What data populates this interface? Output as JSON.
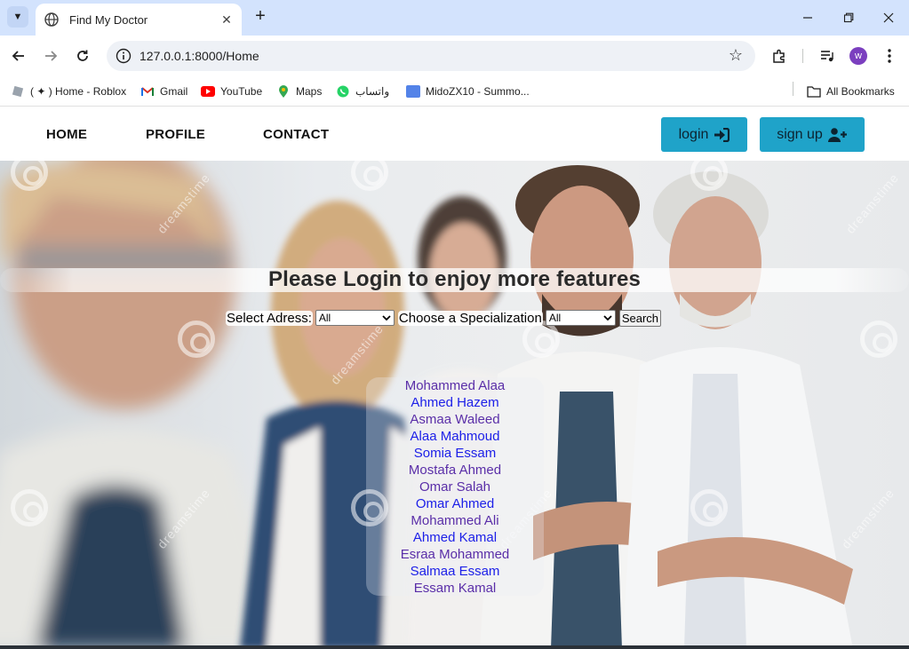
{
  "browser": {
    "tab": {
      "title": "Find My Doctor"
    },
    "url": "127.0.0.1:8000/Home",
    "profile_initial": "w",
    "bookmarks": [
      {
        "label": "( ✦ ) Home - Roblox",
        "icon": "roblox-icon"
      },
      {
        "label": "Gmail",
        "icon": "gmail-icon"
      },
      {
        "label": "YouTube",
        "icon": "youtube-icon"
      },
      {
        "label": "Maps",
        "icon": "maps-icon"
      },
      {
        "label": "واتساب",
        "icon": "whatsapp-icon"
      },
      {
        "label": "MidoZX10 - Summo...",
        "icon": "opgg-icon"
      }
    ],
    "all_bookmarks_label": "All Bookmarks"
  },
  "nav": {
    "links": [
      "HOME",
      "PROFILE",
      "CONTACT"
    ],
    "login_label": "login",
    "signup_label": "sign up",
    "accent": "#1fa3c9"
  },
  "hero": {
    "title": "Please Login to enjoy more features",
    "watermark": "dreamstime"
  },
  "filters": {
    "address_label": "Select Adress:",
    "address_value": "All",
    "specialization_label": "Choose a Specialization",
    "specialization_value": "All",
    "search_label": "Search"
  },
  "doctors": [
    {
      "name": "Mohammed Alaa",
      "visited": true
    },
    {
      "name": "Ahmed Hazem",
      "visited": false
    },
    {
      "name": "Asmaa Waleed",
      "visited": true
    },
    {
      "name": "Alaa Mahmoud",
      "visited": false
    },
    {
      "name": "Somia Essam",
      "visited": false
    },
    {
      "name": "Mostafa Ahmed",
      "visited": true
    },
    {
      "name": "Omar Salah",
      "visited": true
    },
    {
      "name": "Omar Ahmed",
      "visited": false
    },
    {
      "name": "Mohammed Ali",
      "visited": true
    },
    {
      "name": "Ahmed Kamal",
      "visited": false
    },
    {
      "name": "Esraa Mohammed",
      "visited": true
    },
    {
      "name": "Salmaa Essam",
      "visited": false
    },
    {
      "name": "Essam Kamal",
      "visited": true
    }
  ]
}
